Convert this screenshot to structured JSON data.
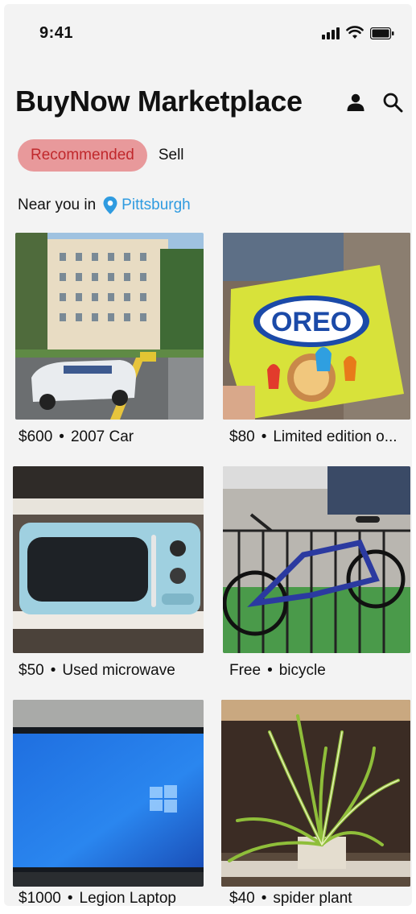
{
  "status_bar": {
    "time": "9:41"
  },
  "header": {
    "title": "BuyNow Marketplace"
  },
  "tabs": [
    {
      "label": "Recommended",
      "active": true
    },
    {
      "label": "Sell",
      "active": false
    }
  ],
  "location": {
    "prefix": "Near you in",
    "city": "Pittsburgh"
  },
  "listings": [
    {
      "price": "$600",
      "title": "2007 Car",
      "image": "classic-car-photo"
    },
    {
      "price": "$80",
      "title": "Limited edition o...",
      "image": "oreo-package-photo"
    },
    {
      "price": "$50",
      "title": "Used microwave",
      "image": "microwave-photo"
    },
    {
      "price": "Free",
      "title": "bicycle",
      "image": "bicycle-photo"
    },
    {
      "price": "$1000",
      "title": "Legion Laptop",
      "image": "laptop-photo"
    },
    {
      "price": "$40",
      "title": "spider plant",
      "image": "spider-plant-photo"
    }
  ],
  "colors": {
    "accent_pill_bg": "#e8999b",
    "accent_pill_text": "#c0282c",
    "link_blue": "#2f9be0"
  },
  "icons": [
    "person-icon",
    "search-icon",
    "location-pin-icon",
    "wifi-icon",
    "battery-icon",
    "signal-icon"
  ]
}
